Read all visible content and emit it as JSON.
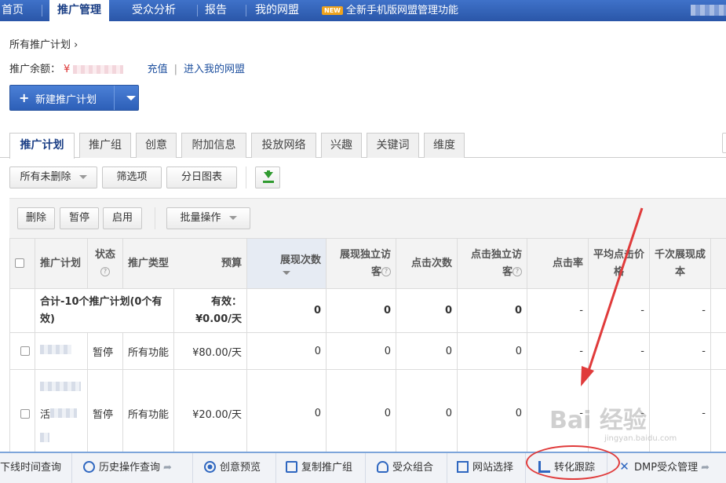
{
  "topnav": {
    "tabs": [
      "首页",
      "推广管理",
      "受众分析",
      "报告",
      "我的网盟"
    ],
    "active_index": 1,
    "promo_badge": "NEW",
    "promo_text": "全新手机版网盟管理功能"
  },
  "breadcrumb": "所有推广计划 ›",
  "balance": {
    "label": "推广余额：",
    "currency": "¥",
    "recharge": "充值",
    "enter_union": "进入我的网盟"
  },
  "new_plan_button": {
    "plus": "+",
    "label": "新建推广计划"
  },
  "tabs": [
    "推广计划",
    "推广组",
    "创意",
    "附加信息",
    "投放网络",
    "兴趣",
    "关键词",
    "维度"
  ],
  "filters": {
    "scope": "所有未删除",
    "filter_btn": "筛选项",
    "daily_chart": "分日图表"
  },
  "actions": {
    "delete": "删除",
    "pause": "暂停",
    "enable": "启用",
    "batch": "批量操作"
  },
  "table": {
    "headers": {
      "plan": "推广计划",
      "status": "状态",
      "type": "推广类型",
      "budget": "预算",
      "impressions": "展现次数",
      "unique_impr_1": "展现独立访",
      "unique_impr_2": "客",
      "clicks": "点击次数",
      "unique_click_1": "点击独立访",
      "unique_click_2": "客",
      "ctr": "点击率",
      "avg_cpc_1": "平均点击价",
      "avg_cpc_2": "格",
      "cpm_1": "千次展现成",
      "cpm_2": "本"
    },
    "help_glyph": "?",
    "summary": {
      "plan_1": "合计-10个推广计划(0个有",
      "plan_2": "效)",
      "budget_1": "有效：",
      "budget_2": "¥0.00/天",
      "impressions": "0",
      "unique_impr": "0",
      "clicks": "0",
      "unique_click": "0",
      "ctr": "-",
      "avg_cpc": "-",
      "cpm": "-"
    },
    "rows": [
      {
        "status": "暂停",
        "type": "所有功能",
        "budget": "¥80.00/天",
        "impressions": "0",
        "unique_impr": "0",
        "clicks": "0",
        "unique_click": "0",
        "ctr": "-",
        "avg_cpc": "-",
        "cpm": "-"
      },
      {
        "plan_prefix": "活",
        "status": "暂停",
        "type": "所有功能",
        "budget": "¥20.00/天",
        "impressions": "0",
        "unique_impr": "0",
        "clicks": "0",
        "unique_click": "0",
        "ctr": "-",
        "avg_cpc": "-",
        "cpm": "-"
      }
    ]
  },
  "bottombar": {
    "offline_query": "下线时间查询",
    "history": "历史操作查询",
    "creative_preview": "创意预览",
    "copy_group": "复制推广组",
    "audience_combo": "受众组合",
    "site_select": "网站选择",
    "conversion": "转化跟踪",
    "dmp": "DMP受众管理"
  },
  "watermark": {
    "brand": "Bai 经验",
    "sub": "jingyan.baidu.com"
  },
  "colors": {
    "nav_blue": "#2a56a8",
    "link_blue": "#1d4f9e",
    "pause_yellow": "#d6a000",
    "annotation_red": "#e03b3b"
  }
}
